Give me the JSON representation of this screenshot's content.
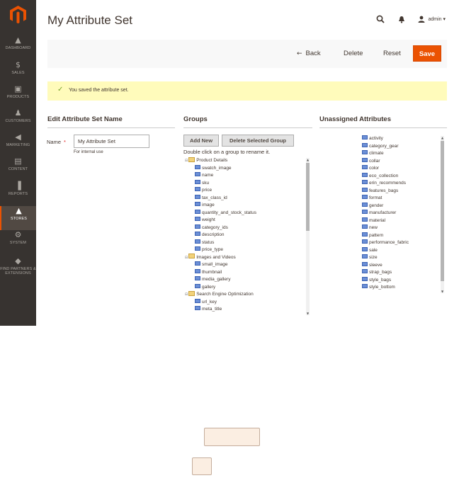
{
  "page": {
    "title": "My Attribute Set"
  },
  "header": {
    "search_icon": "search-icon",
    "bell_icon": "bell-icon",
    "user_label": "admin ▾"
  },
  "sidebar": {
    "items": [
      {
        "label": "DASHBOARD",
        "icon": "dashboard-icon",
        "glyph": "▲"
      },
      {
        "label": "SALES",
        "icon": "dollar-icon",
        "glyph": "$"
      },
      {
        "label": "PRODUCTS",
        "icon": "box-icon",
        "glyph": "▣"
      },
      {
        "label": "CUSTOMERS",
        "icon": "person-icon",
        "glyph": "♟"
      },
      {
        "label": "MARKETING",
        "icon": "megaphone-icon",
        "glyph": "◀"
      },
      {
        "label": "CONTENT",
        "icon": "content-icon",
        "glyph": "▤"
      },
      {
        "label": "REPORTS",
        "icon": "bar-chart-icon",
        "glyph": "▐"
      },
      {
        "label": "STORES",
        "icon": "store-icon",
        "glyph": "▲"
      },
      {
        "label": "SYSTEM",
        "icon": "gear-icon",
        "glyph": "⚙"
      },
      {
        "label": "FIND PARTNERS & EXTENSIONS",
        "icon": "cube-icon",
        "glyph": "◆"
      }
    ],
    "active": "STORES"
  },
  "actions": {
    "back": "Back",
    "delete": "Delete",
    "reset": "Reset",
    "save": "Save"
  },
  "message": {
    "text": "You saved the attribute set."
  },
  "edit": {
    "title": "Edit Attribute Set Name",
    "name_label": "Name",
    "required_mark": "*",
    "name_value": "My Attribute Set",
    "note": "For internal use"
  },
  "groups": {
    "title": "Groups",
    "add_new": "Add New",
    "delete_selected": "Delete Selected Group",
    "hint": "Double click on a group to rename it.",
    "tree": [
      {
        "text": "Product Details",
        "type": "folder"
      },
      {
        "text": "swatch_image",
        "type": "attr"
      },
      {
        "text": "name",
        "type": "attr"
      },
      {
        "text": "sku",
        "type": "attr"
      },
      {
        "text": "price",
        "type": "attr"
      },
      {
        "text": "tax_class_id",
        "type": "attr"
      },
      {
        "text": "image",
        "type": "attr"
      },
      {
        "text": "quantity_and_stock_status",
        "type": "attr"
      },
      {
        "text": "weight",
        "type": "attr"
      },
      {
        "text": "category_ids",
        "type": "attr"
      },
      {
        "text": "description",
        "type": "attr"
      },
      {
        "text": "status",
        "type": "attr"
      },
      {
        "text": "price_type",
        "type": "attr"
      },
      {
        "text": "Images and Videos",
        "type": "folder"
      },
      {
        "text": "small_image",
        "type": "attr"
      },
      {
        "text": "thumbnail",
        "type": "attr"
      },
      {
        "text": "media_gallery",
        "type": "attr"
      },
      {
        "text": "gallery",
        "type": "attr"
      },
      {
        "text": "Search Engine Optimization",
        "type": "folder"
      },
      {
        "text": "url_key",
        "type": "attr"
      },
      {
        "text": "meta_title",
        "type": "attr"
      }
    ]
  },
  "unassigned": {
    "title": "Unassigned Attributes",
    "items": [
      "activity",
      "category_gear",
      "climate",
      "collar",
      "color",
      "eco_collection",
      "erin_recommends",
      "features_bags",
      "format",
      "gender",
      "manufacturer",
      "material",
      "new",
      "pattern",
      "performance_fabric",
      "sale",
      "size",
      "sleeve",
      "strap_bags",
      "style_bags",
      "style_bottom"
    ]
  },
  "colors": {
    "accent": "#eb5202",
    "sidebar": "#373330",
    "message_bg": "#fffbbb"
  }
}
